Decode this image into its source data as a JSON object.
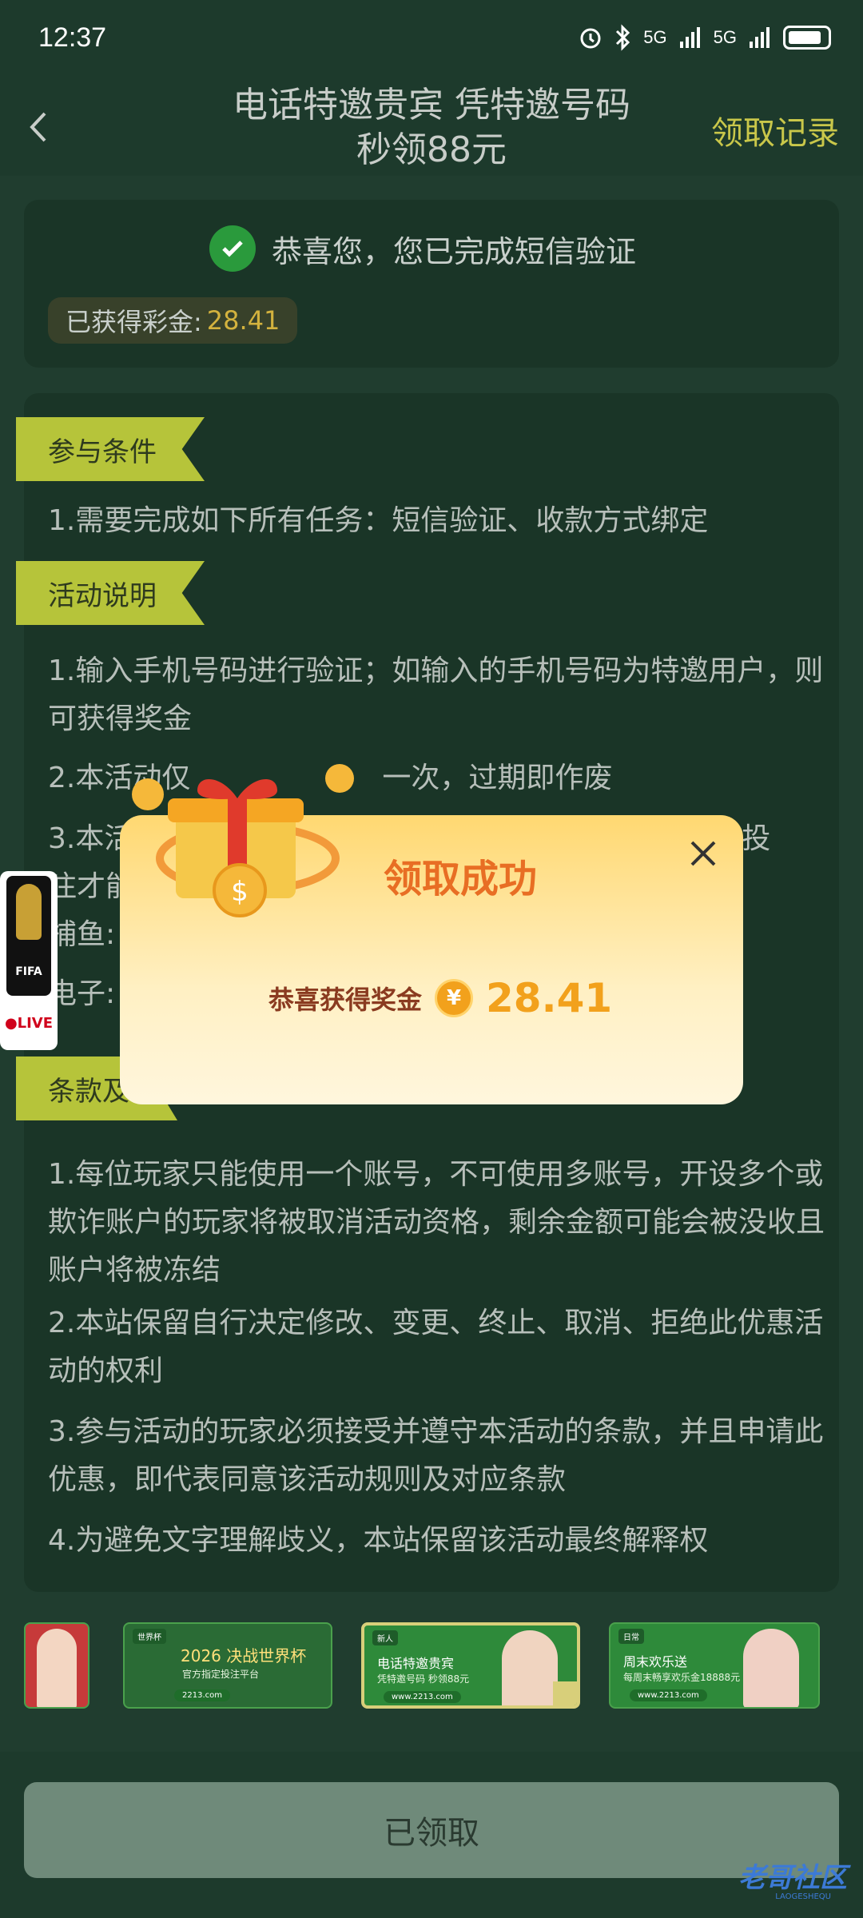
{
  "status_bar": {
    "time": "12:37",
    "net1": "5G",
    "net2": "5G"
  },
  "header": {
    "title_line1": "电话特邀贵宾 凭特邀号码",
    "title_line2": "秒领88元",
    "record_link": "领取记录"
  },
  "verify_card": {
    "message": "恭喜您，您已完成短信验证",
    "bonus_label": "已获得彩金:",
    "bonus_amount": "28.41"
  },
  "rules": {
    "section1_title": "参与条件",
    "section1_items": [
      "1.需要完成如下所有任务：短信验证、收款方式绑定"
    ],
    "section2_title": "活动说明",
    "section2_items": [
      "1.输入手机号码进行验证；如输入的手机号码为特邀用户，则可获得奖金",
      "2.本活动仅",
      "一次，过期即作废",
      "3.本活动",
      "效投",
      "注才能",
      "捕鱼:",
      "电子:"
    ],
    "section3_title": "条款及",
    "section3_items": [
      "1.每位玩家只能使用一个账号，不可使用多账号，开设多个或欺诈账户的玩家将被取消活动资格，剩余金额可能会被没收且账户将被冻结",
      "2.本站保留自行决定修改、变更、终止、取消、拒绝此优惠活动的权利",
      "3.参与活动的玩家必须接受并遵守本活动的条款，并且申请此优惠，即代表同意该活动规则及对应条款",
      "4.为避免文字理解歧义，本站保留该活动最终解释权"
    ]
  },
  "promos": [
    {
      "tag": "",
      "title": "",
      "sub": "",
      "url": ""
    },
    {
      "tag": "世界杯",
      "title": "2026 决战世界杯",
      "sub": "官方指定投注平台",
      "url": "2213.com"
    },
    {
      "tag": "新人",
      "title": "电话特邀贵宾",
      "sub": "凭特邀号码 秒领88元",
      "url": "www.2213.com"
    },
    {
      "tag": "日常",
      "title": "周末欢乐送",
      "sub": "每周末畅享欢乐金18888元",
      "url": "www.2213.com"
    }
  ],
  "bottom": {
    "button_label": "已领取",
    "watermark": "老哥社区",
    "watermark_sub": "LAOGESHEQU"
  },
  "floating_badge": {
    "label": "FIFA",
    "live": "●LIVE"
  },
  "modal": {
    "title": "领取成功",
    "reward_label": "恭喜获得奖金",
    "currency_symbol": "¥",
    "reward_amount": "28.41"
  },
  "colors": {
    "background": "#203d2f",
    "card": "#1a3527",
    "accent_yellow": "#c9c74a",
    "ribbon": "#b6c43a",
    "reward_orange": "#f2a11c",
    "title_orange": "#e86e24"
  }
}
